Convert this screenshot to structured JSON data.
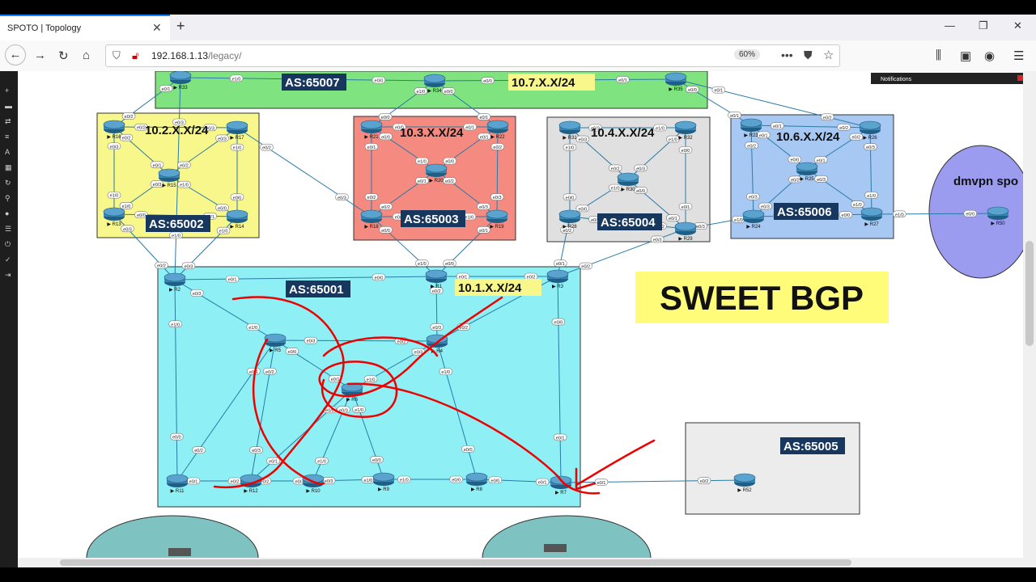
{
  "browser": {
    "tab_title": "SPOTO | Topology",
    "url_host": "192.168.1.13",
    "url_path": "/legacy/",
    "zoom": "60%",
    "notifications_label": "Notifications"
  },
  "sidebar": {
    "icons": [
      "plus-icon",
      "node-icon",
      "swap-icon",
      "list-icon",
      "text-icon",
      "grid-icon",
      "refresh-icon",
      "zoom-icon",
      "info-icon",
      "doc-icon",
      "power-icon",
      "check-icon",
      "logout-icon"
    ]
  },
  "topology": {
    "banner": "SWEET BGP",
    "areas": [
      {
        "id": "as65007",
        "as": "AS:65007",
        "subnet": "10.7.X.X/24",
        "color": "#7fe47f"
      },
      {
        "id": "as65002",
        "as": "AS:65002",
        "subnet": "10.2.X.X/24",
        "color": "#f7f78b"
      },
      {
        "id": "as65003",
        "as": "AS:65003",
        "subnet": "10.3.X.X/24",
        "color": "#f58a80"
      },
      {
        "id": "as65004",
        "as": "AS:65004",
        "subnet": "10.4.X.X/24",
        "color": "#e0e0e0"
      },
      {
        "id": "as65006",
        "as": "AS:65006",
        "subnet": "10.6.X.X/24",
        "color": "#a6c8f2"
      },
      {
        "id": "as65001",
        "as": "AS:65001",
        "subnet": "10.1.X.X/24",
        "color": "#8ef0f5"
      },
      {
        "id": "as65005",
        "as": "AS:65005",
        "subnet": "",
        "color": "#ececec"
      }
    ],
    "dmvpn_label": "dmvpn spo",
    "routers": [
      "R1",
      "R2",
      "R3",
      "R4",
      "R5",
      "R6",
      "R7",
      "R8",
      "R9",
      "R10",
      "R11",
      "R12",
      "R13",
      "R14",
      "R15",
      "R16",
      "R17",
      "R18",
      "R19",
      "R20",
      "R21",
      "R22",
      "R23",
      "R24",
      "R25",
      "R26",
      "R27",
      "R28",
      "R29",
      "R30",
      "R31",
      "R32",
      "R33",
      "R34",
      "R35",
      "R50",
      "R52"
    ],
    "port_labels": [
      "e0/0",
      "e0/1",
      "e0/2",
      "e0/3",
      "e1/0"
    ]
  }
}
